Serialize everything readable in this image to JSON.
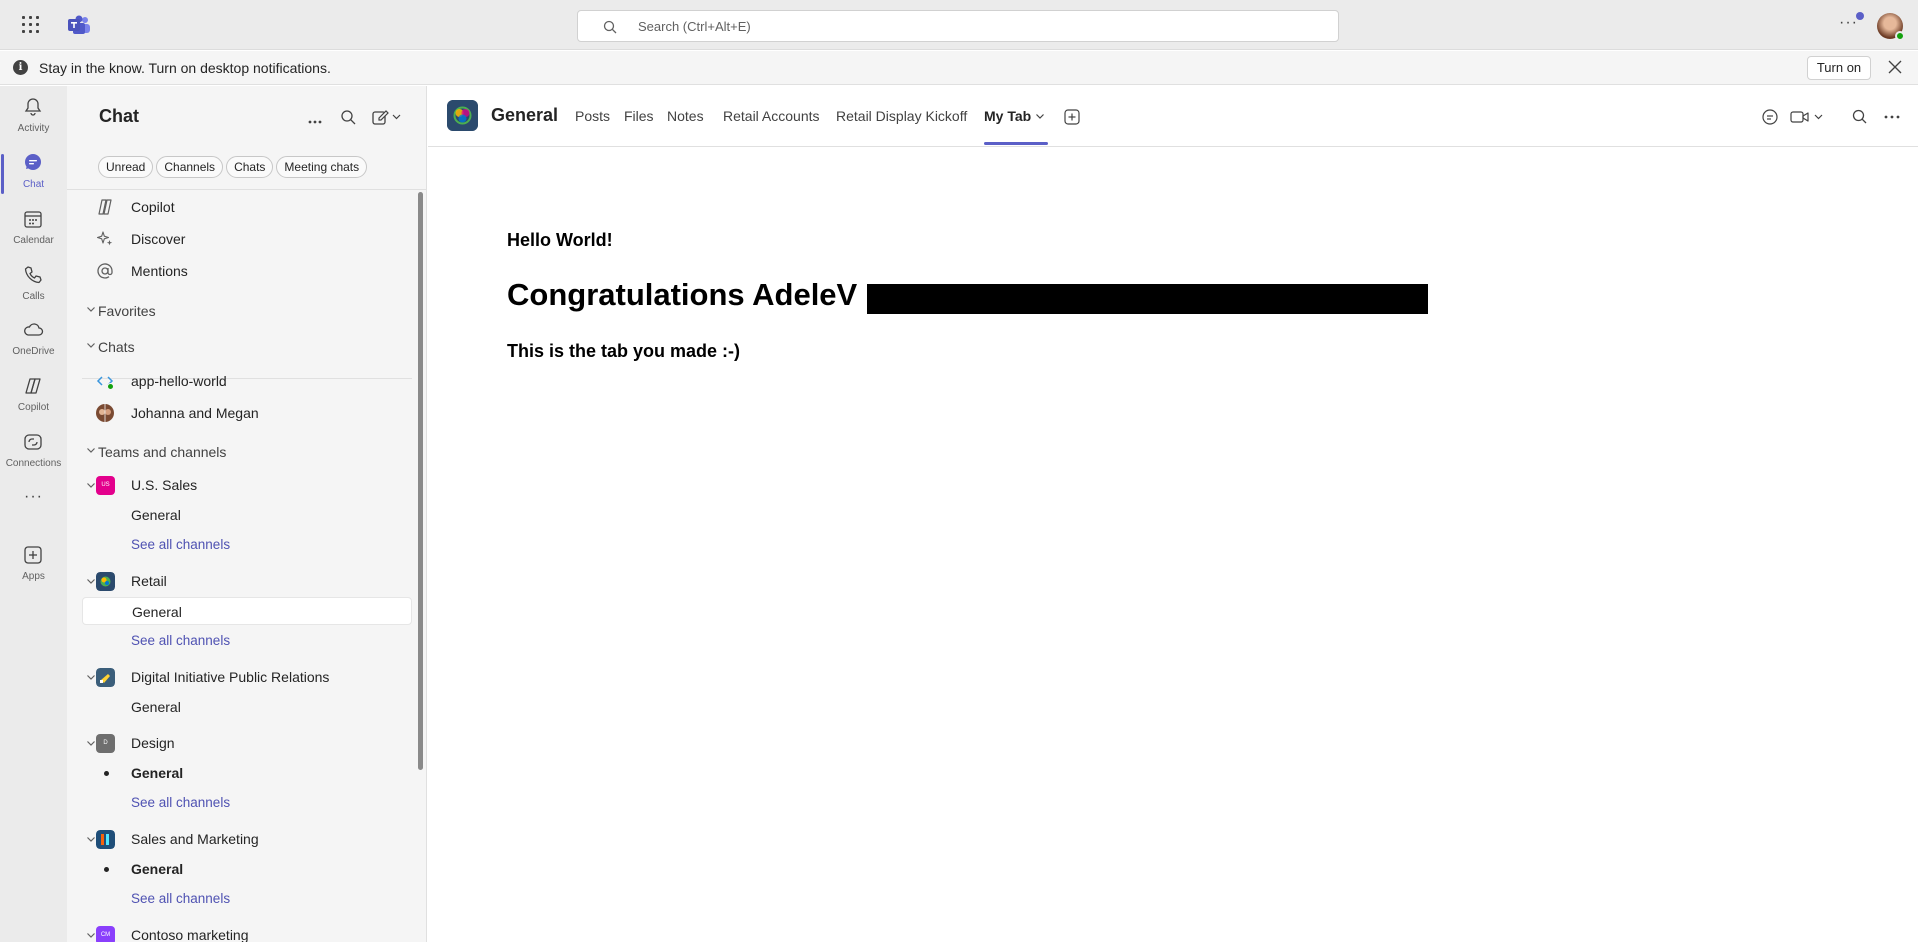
{
  "topbar": {
    "search_placeholder": "Search (Ctrl+Alt+E)",
    "more_label": "···"
  },
  "notification": {
    "message": "Stay in the know. Turn on desktop notifications.",
    "button": "Turn on"
  },
  "rail": {
    "items": [
      {
        "label": "Activity",
        "icon": "bell-icon"
      },
      {
        "label": "Chat",
        "icon": "chat-icon"
      },
      {
        "label": "Calendar",
        "icon": "calendar-icon"
      },
      {
        "label": "Calls",
        "icon": "phone-icon"
      },
      {
        "label": "OneDrive",
        "icon": "cloud-icon"
      },
      {
        "label": "Copilot",
        "icon": "copilot-icon"
      },
      {
        "label": "Connections",
        "icon": "connections-icon"
      },
      {
        "label": "Apps",
        "icon": "add-app-icon"
      }
    ],
    "more_label": "···",
    "active": "Chat"
  },
  "pane": {
    "title": "Chat",
    "filters": [
      "Unread",
      "Channels",
      "Chats",
      "Meeting chats"
    ],
    "pinned": [
      {
        "label": "Copilot"
      },
      {
        "label": "Discover"
      },
      {
        "label": "Mentions"
      }
    ],
    "sections": {
      "favorites": "Favorites",
      "chats": "Chats",
      "teams": "Teams and channels"
    },
    "chats": [
      {
        "label": "app-hello-world"
      },
      {
        "label": "Johanna and Megan"
      }
    ],
    "teams": [
      {
        "name": "U.S. Sales",
        "abbr": "US",
        "color": "#e3008c",
        "channel": "General",
        "see_all": "See all channels"
      },
      {
        "name": "Retail",
        "abbr": "",
        "color": "#2b4a6d",
        "channel": "General",
        "see_all": "See all channels"
      },
      {
        "name": "Digital Initiative Public Relations",
        "abbr": "",
        "color": "#3b5e7a",
        "channel": "General"
      },
      {
        "name": "Design",
        "abbr": "D",
        "color": "#6e6e6e",
        "channel": "General",
        "see_all": "See all channels"
      },
      {
        "name": "Sales and Marketing",
        "abbr": "",
        "color": "#1f4e79",
        "channel": "General",
        "see_all": "See all channels"
      },
      {
        "name": "Contoso marketing",
        "abbr": "CM",
        "color": "#8a3ffc"
      }
    ]
  },
  "channel": {
    "name": "General",
    "tabs": [
      "Posts",
      "Files",
      "Notes",
      "Retail Accounts",
      "Retail Display Kickoff",
      "My Tab"
    ],
    "active_tab": "My Tab"
  },
  "content": {
    "hello": "Hello World!",
    "congrats": "Congratulations AdeleV",
    "tab_text": "This is the tab you made :-)"
  },
  "colors": {
    "accent": "#5b5fc7",
    "link": "#4f52b2",
    "rail_bg": "#ebebeb",
    "pane_bg": "#f5f5f5"
  }
}
